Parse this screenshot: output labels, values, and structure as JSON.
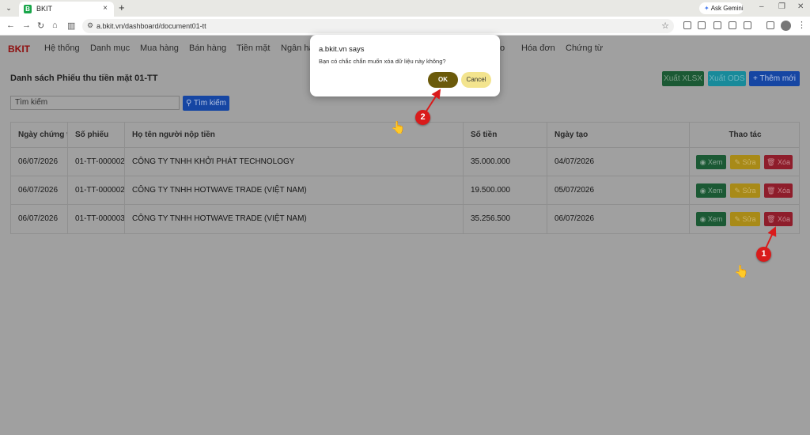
{
  "browser": {
    "tab_title": "BKIT",
    "tab_favicon": "B",
    "new_tab": "+",
    "ask_gemini": "Ask Gemini",
    "url": "a.bkit.vn/dashboard/document01-tt"
  },
  "nav": {
    "brand": "BKIT",
    "items": [
      "Hệ thống",
      "Danh mục",
      "Mua hàng",
      "Bán hàng",
      "Tiền mặt",
      "Ngân hà",
      "o",
      "Hóa đơn",
      "Chứng từ"
    ]
  },
  "page": {
    "title": "Danh sách Phiếu thu tiền mặt 01-TT",
    "export_xlsx": "Xuất XLSX",
    "export_ods": "Xuất ODS",
    "add_new": "+ Thêm mới",
    "search_placeholder": "Tìm kiếm",
    "search_button": "Tìm kiếm"
  },
  "table": {
    "headers": [
      "Ngày chứng t",
      "Số phiếu",
      "Họ tên người nộp tiền",
      "Số tiền",
      "Ngày tạo",
      "Thao tác"
    ],
    "rows": [
      [
        "06/07/2026",
        "01-TT-000002",
        "CÔNG TY TNHH KHỞI PHÁT TECHNOLOGY",
        "35.000.000",
        "04/07/2026"
      ],
      [
        "06/07/2026",
        "01-TT-000002",
        "CÔNG TY TNHH HOTWAVE TRADE (VIỆT NAM)",
        "19.500.000",
        "05/07/2026"
      ],
      [
        "06/07/2026",
        "01-TT-000003",
        "CÔNG TY TNHH HOTWAVE TRADE (VIỆT NAM)",
        "35.256.500",
        "06/07/2026"
      ]
    ],
    "actions": {
      "view": "Xem",
      "edit": "Sửa",
      "delete": "Xóa"
    }
  },
  "dialog": {
    "title": "a.bkit.vn says",
    "message": "Bạn có chắc chắn muốn xóa dữ liệu này không?",
    "ok": "OK",
    "cancel": "Cancel"
  },
  "annotations": {
    "marker_1": "1",
    "marker_2": "2"
  },
  "colors": {
    "brand": "#8e0f0f",
    "marker": "#d91b1b",
    "ok_button": "#6b5a0a",
    "cancel_button": "#f3e48e"
  }
}
